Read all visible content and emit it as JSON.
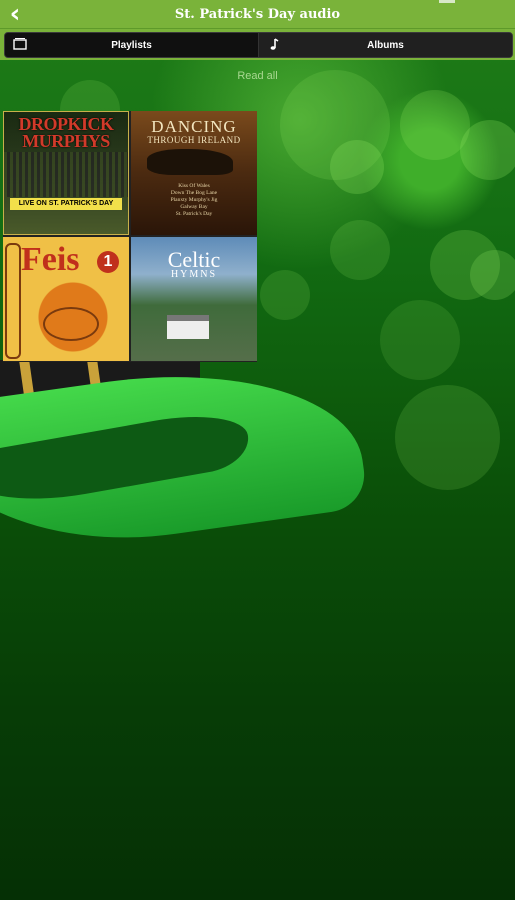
{
  "header": {
    "title": "St. Patrick's Day audio",
    "back_icon": "chevron-left-icon"
  },
  "tabs": [
    {
      "label": "Playlists",
      "icon": "playlist-icon"
    },
    {
      "label": "Albums",
      "icon": "music-note-icon"
    }
  ],
  "read_all": "Read all",
  "albums": [
    {
      "title": "DROPKICK MURPHYS",
      "strip": "LIVE ON ST. PATRICK'S DAY"
    },
    {
      "title_line1": "DANCING",
      "title_line2": "THROUGH IRELAND",
      "tracks": [
        "Kiss Of Wales",
        "Down The Bog Lane",
        "Planxty Murphy's Jig",
        "Galway Bay",
        "St. Patrick's Day"
      ]
    },
    {
      "title": "Feis",
      "number": "1"
    },
    {
      "title_line1": "Celtic",
      "title_line2": "HYMNS"
    }
  ],
  "colors": {
    "titlebar": "#7ab33a",
    "tabbar": "#1b1b1b",
    "background_green": "#0b5209"
  }
}
